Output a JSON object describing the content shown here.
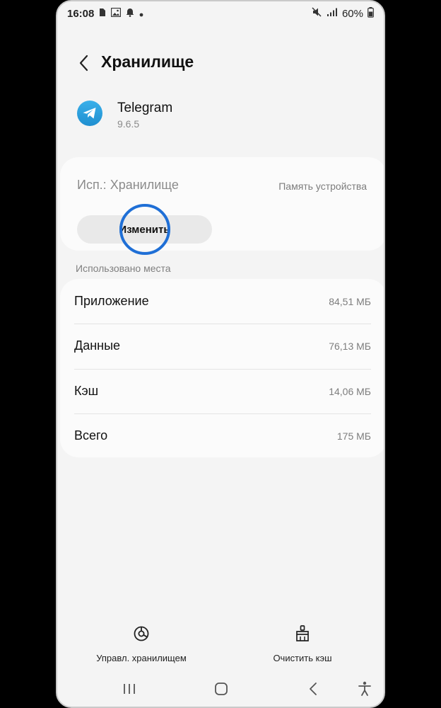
{
  "status_bar": {
    "time": "16:08",
    "battery": "60%",
    "icons": [
      "sim-card-icon",
      "gallery-icon",
      "bell-icon",
      "dot-icon",
      "mute-icon",
      "signal-icon",
      "battery-icon"
    ]
  },
  "header": {
    "title": "Хранилище"
  },
  "app": {
    "name": "Telegram",
    "version": "9.6.5",
    "icon": "telegram-icon",
    "brand_color": "#2a9fe0"
  },
  "storage_location": {
    "label": "Исп.: Хранилище",
    "value": "Память устройства",
    "change_button": "Изменить"
  },
  "usage": {
    "section_label": "Использовано места",
    "rows": [
      {
        "name": "Приложение",
        "value": "84,51 МБ"
      },
      {
        "name": "Данные",
        "value": "76,13 МБ"
      },
      {
        "name": "Кэш",
        "value": "14,06 МБ"
      },
      {
        "name": "Всего",
        "value": "175 МБ"
      }
    ]
  },
  "actions": {
    "manage_storage": "Управл. хранилищем",
    "clear_cache": "Очистить кэш"
  },
  "colors": {
    "tap_ring": "#1f6fd6",
    "background": "#f4f4f4"
  }
}
